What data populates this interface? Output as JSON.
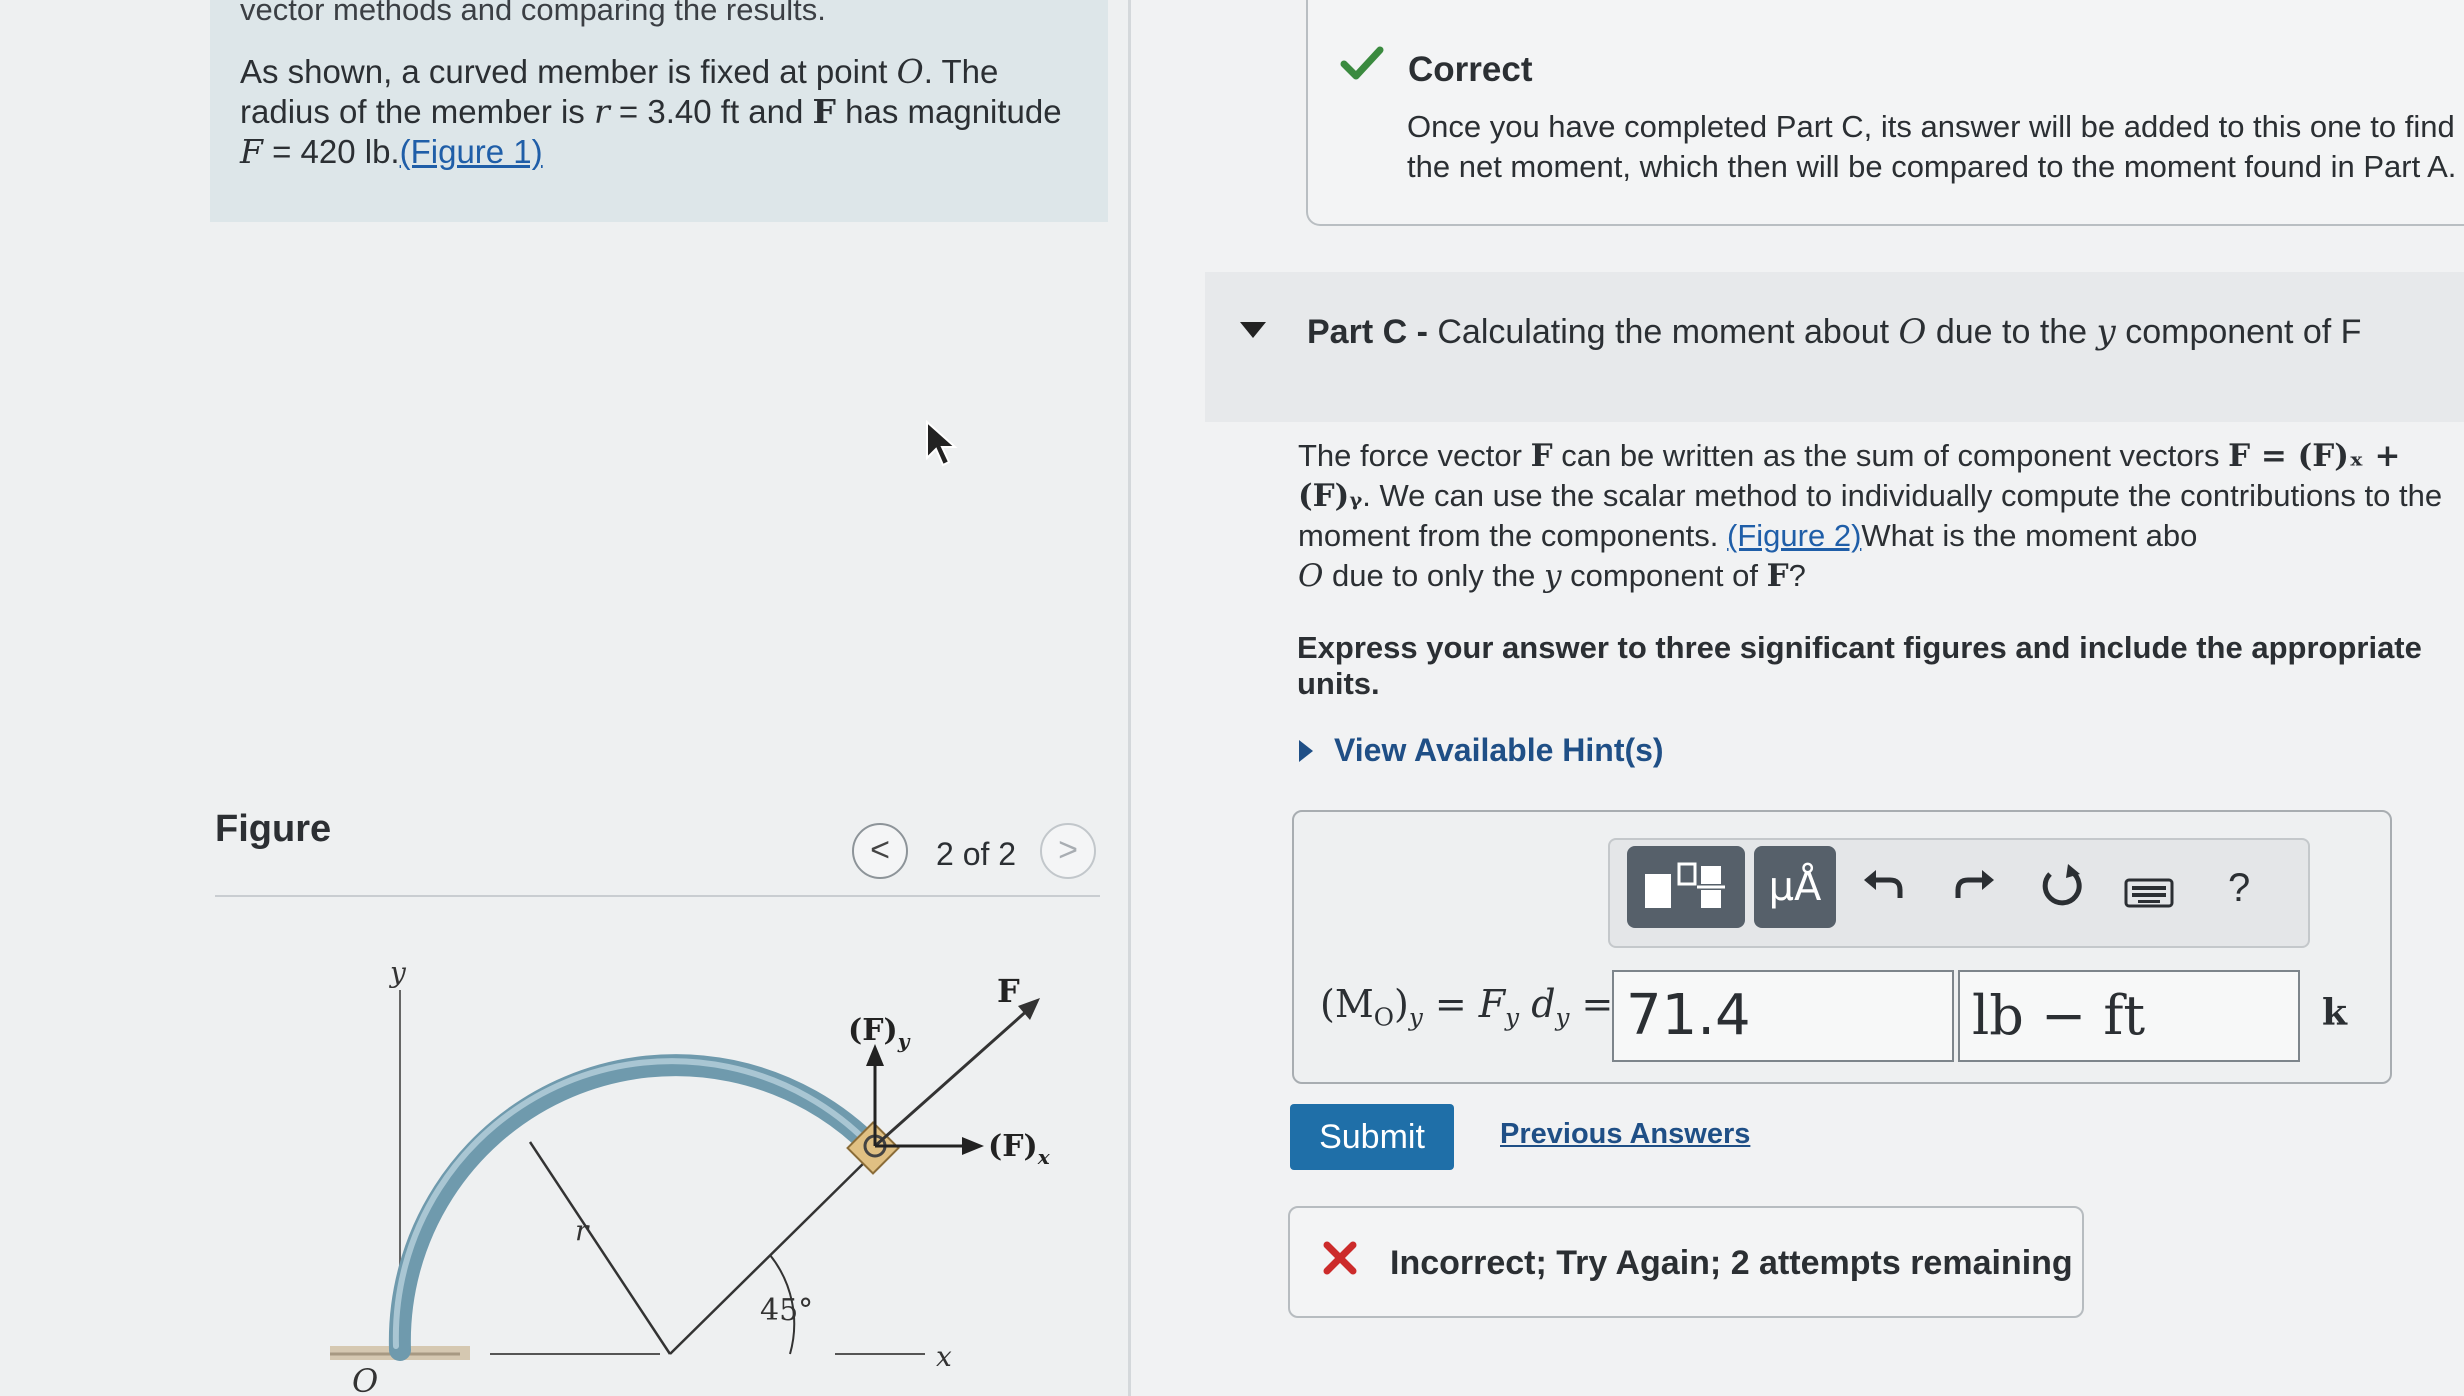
{
  "problem": {
    "intro_cut": "vector methods and comparing the results.",
    "text_a": "As shown, a curved member is fixed at point ",
    "point": "O",
    "text_b": ". The radius of the member is ",
    "r_sym": "r",
    "r_value": " = 3.40 ft",
    "text_c": " and ",
    "F_bold": "F",
    "text_d": " has magnitude ",
    "F_sym": "F",
    "F_value": " = 420 lb.",
    "figure_link": "(Figure 1)"
  },
  "figure": {
    "title": "Figure",
    "counter": "2 of 2",
    "prev": "<",
    "next": ">",
    "labels": {
      "y": "y",
      "x": "x",
      "F": "F",
      "Fy": "(F)",
      "Fy_sub": "y",
      "Fx": "(F)",
      "Fx_sub": "x",
      "r": "r",
      "angle": "45°",
      "O": "O"
    }
  },
  "correct": {
    "title": "Correct",
    "text": "Once you have completed Part C, its answer will be added to this one to find the net moment, which then will be compared to the moment found in Part A."
  },
  "part": {
    "label": "Part C -",
    "title_a": " Calculating the moment about ",
    "title_O": "O",
    "title_b": " due to the ",
    "title_y": "y",
    "title_c": " component of F"
  },
  "question": {
    "a": "The force vector ",
    "F": "F",
    "b": " can be written as the sum of component vectors ",
    "eq": "F = (F)ₓ + (F)ᵧ",
    "c": ". We can use the scalar method to individually compute the contributions to the moment from the components. ",
    "link": "(Figure 2)",
    "d": "What is the moment abo",
    "O": "O",
    "e": " due to only the ",
    "y": "y",
    "f": " component of ",
    "F2": "F",
    "g": "?"
  },
  "express": "Express your answer to three significant figures and include the appropriate units.",
  "hint": "View Available Hint(s)",
  "toolbar": {
    "units_label": "μÅ",
    "help": "?"
  },
  "answer": {
    "label": "(M_O)_y = F_y d_y =",
    "label_display": "(MO)y = Fydy =",
    "value": "71.4",
    "units": "lb − ft",
    "k": "k"
  },
  "submit_label": "Submit",
  "previous_answers": "Previous Answers",
  "feedback": "Incorrect; Try Again; 2 attempts remaining",
  "colors": {
    "accent": "#1f6fa8",
    "check": "#3a8a3f",
    "error": "#cc2b2b",
    "member": "#6f9aad"
  }
}
